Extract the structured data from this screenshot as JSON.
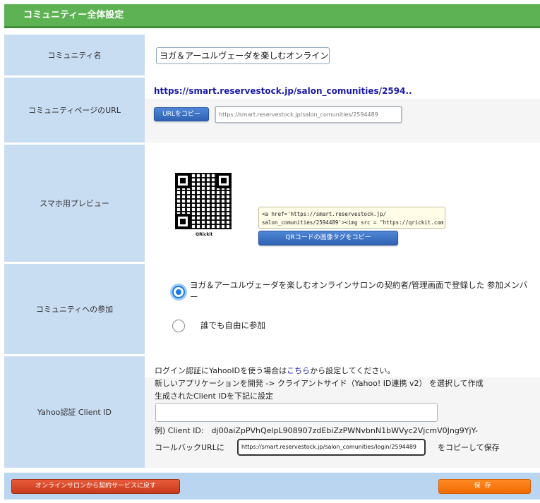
{
  "header": {
    "title": "コミュニティー全体設定"
  },
  "community_name": {
    "label": "コミュニティ名",
    "value": "ヨガ＆アーユルヴェーダを楽しむオンラインサ"
  },
  "community_url": {
    "label": "コミュニティページのURL",
    "link": "https://smart.reservestock.jp/salon_comunities/2594..",
    "copy_button": "URLをコピー",
    "field_value": "https://smart.reservestock.jp/salon_comunities/2594489"
  },
  "preview": {
    "label": "スマホ用プレビュー",
    "qr_caption": "QRickit",
    "tag_line1": "<a href='https://smart.reservestock.jp/",
    "tag_line2": "salon_comunities/2594489'><img src = \"https://qrickit.com",
    "copy_tag_button": "QRコードの画像タグをコピー"
  },
  "join": {
    "label": "コミュニティへの参加",
    "options": [
      {
        "label": "ヨガ＆アーユルヴェーダを楽しむオンラインサロンの契約者/管理画面で登録した 参加メンバー",
        "selected": true
      },
      {
        "label": "誰でも自由に参加",
        "selected": false
      }
    ]
  },
  "yahoo": {
    "label": "Yahoo認証 Client ID",
    "line1_before": "ログイン認証にYahooIDを使う場合は",
    "line1_link": "こちら",
    "line1_after": "から設定してください。",
    "line2": "新しいアプリケーションを開発 -> クライアントサイド（Yahoo! ID連携 v2） を選択して作成",
    "line3": "生成されたClient IDを下記に設定",
    "client_id_value": "",
    "example": "例) Client ID:　dj00aiZpPVhQelpL908907zdEbiZzPWNvbnN1bWVyc2VjcmV0Jng9YjY-",
    "callback_label": "コールバックURLに",
    "callback_value": "https://smart.reservestock.jp/salon_comunities/login/2594489",
    "callback_after": "をコピーして保存"
  },
  "footer": {
    "back_button": "オンラインサロンから契約サービスに戻す",
    "save_button": "保存"
  },
  "colors": {
    "header_green": "#5db353",
    "label_blue": "#c8dcf2",
    "button_blue": "#2f62b3",
    "button_red": "#c83a1b",
    "button_orange": "#f06b00"
  }
}
